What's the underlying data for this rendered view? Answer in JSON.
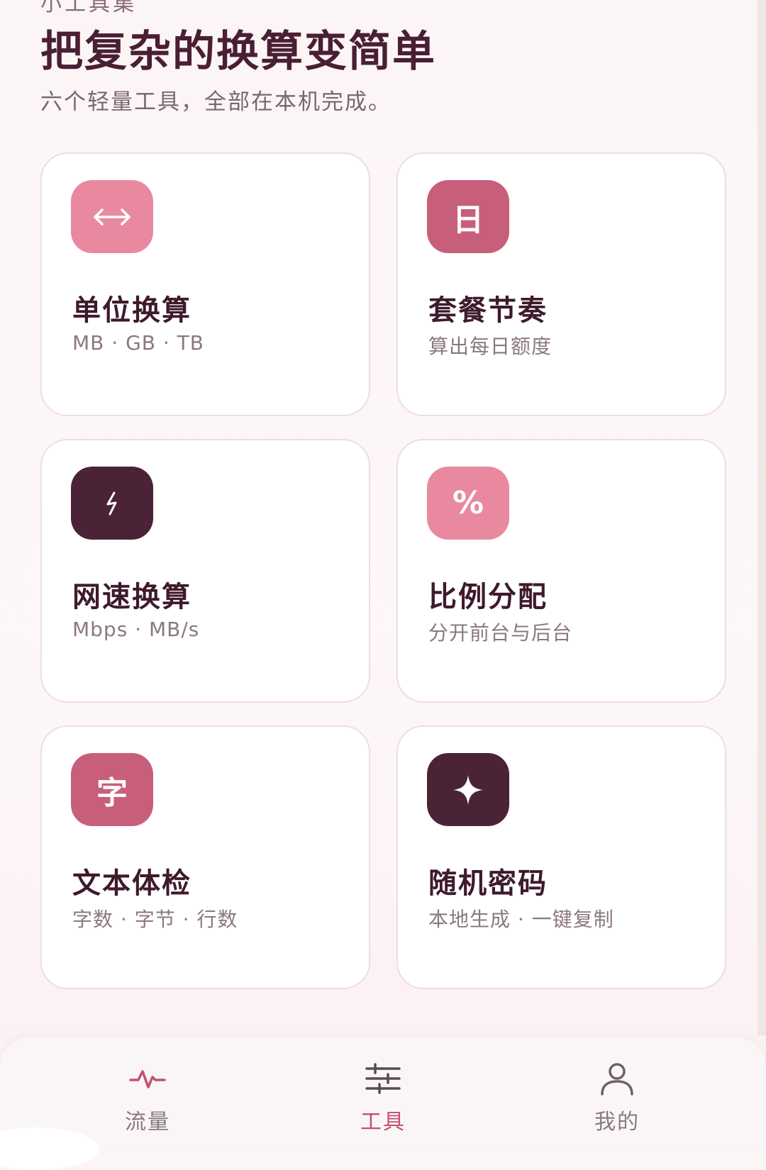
{
  "header": {
    "eyebrow": "小工具集",
    "title": "把复杂的换算变简单",
    "subtitle": "六个轻量工具，全部在本机完成。"
  },
  "tools": [
    {
      "id": "unit-convert",
      "title": "单位换算",
      "subtitle": "MB · GB · TB",
      "icon": "arrows-horizontal-icon",
      "icon_color": "#e8899f"
    },
    {
      "id": "plan-rhythm",
      "title": "套餐节奏",
      "subtitle": "算出每日额度",
      "icon": "calendar-day-icon",
      "icon_glyph": "日",
      "icon_color": "#c85f7a"
    },
    {
      "id": "speed-convert",
      "title": "网速换算",
      "subtitle": "Mbps · MB/s",
      "icon": "lightning-icon",
      "icon_color": "#4a2436"
    },
    {
      "id": "ratio-split",
      "title": "比例分配",
      "subtitle": "分开前台与后台",
      "icon": "percent-icon",
      "icon_glyph": "%",
      "icon_color": "#e8899f"
    },
    {
      "id": "text-check",
      "title": "文本体检",
      "subtitle": "字数 · 字节 · 行数",
      "icon": "character-icon",
      "icon_glyph": "字",
      "icon_color": "#c85f7a"
    },
    {
      "id": "random-password",
      "title": "随机密码",
      "subtitle": "本地生成 · 一键复制",
      "icon": "sparkle-icon",
      "icon_color": "#4a2436"
    }
  ],
  "nav": {
    "items": [
      {
        "label": "流量",
        "icon": "pulse-icon",
        "active": false
      },
      {
        "label": "工具",
        "icon": "sliders-icon",
        "active": true
      },
      {
        "label": "我的",
        "icon": "person-icon",
        "active": false
      }
    ]
  },
  "colors": {
    "accent": "#c4506f",
    "title_text": "#4a1f33",
    "muted_text": "#8b7880"
  }
}
